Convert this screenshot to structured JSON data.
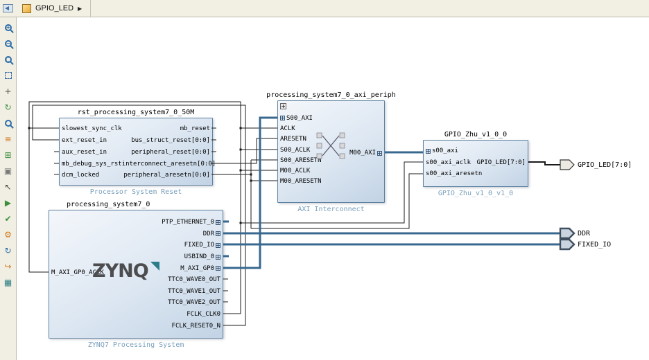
{
  "window": {
    "tab": {
      "label": "GPIO_LED",
      "arrow": "▶"
    }
  },
  "toolbar": {
    "icons": [
      {
        "name": "zoom-in",
        "badge": "+"
      },
      {
        "name": "zoom-out",
        "badge": "−"
      },
      {
        "name": "zoom-fit",
        "badge": "□"
      },
      {
        "name": "select-area"
      },
      {
        "name": "fit-selection",
        "glyph": "+"
      },
      {
        "name": "autofit-selection",
        "glyph": "↻"
      },
      {
        "name": "search",
        "badge": ""
      },
      {
        "name": "collapse-expand",
        "glyph": "≡"
      },
      {
        "name": "add-ip",
        "glyph": "⊞"
      },
      {
        "name": "add-hierarchy",
        "glyph": "▣"
      },
      {
        "name": "make-external",
        "glyph": "↖"
      },
      {
        "name": "run-automation",
        "glyph": "▶"
      },
      {
        "name": "validate-design",
        "glyph": "✔"
      },
      {
        "name": "settings",
        "glyph": "⚙"
      },
      {
        "name": "regenerate-layout",
        "glyph": "↻"
      },
      {
        "name": "optimize-routing",
        "glyph": "↪"
      },
      {
        "name": "toggle-grid",
        "glyph": "▦"
      }
    ]
  },
  "diagram": {
    "blocks": {
      "reset": {
        "instance": "rst_processing_system7_0_50M",
        "type_label": "Processor System Reset",
        "left_ports": [
          "slowest_sync_clk",
          "ext_reset_in",
          "aux_reset_in",
          "mb_debug_sys_rst",
          "dcm_locked"
        ],
        "right_ports": [
          "mb_reset",
          "bus_struct_reset[0:0]",
          "peripheral_reset[0:0]",
          "interconnect_aresetn[0:0]",
          "peripheral_aresetn[0:0]"
        ]
      },
      "axi": {
        "instance": "processing_system7_0_axi_periph",
        "type_label": "AXI Interconnect",
        "left_ports": [
          "S00_AXI",
          "ACLK",
          "ARESETN",
          "S00_ACLK",
          "S00_ARESETN",
          "M00_ACLK",
          "M00_ARESETN"
        ],
        "right_ports": [
          "M00_AXI"
        ]
      },
      "gpio": {
        "instance": "GPIO_Zhu_v1_0_0",
        "type_label": "GPIO_Zhu_v1_0_v1_0",
        "left_ports": [
          "s00_axi",
          "s00_axi_aclk",
          "s00_axi_aresetn"
        ],
        "right_ports": [
          "GPIO_LED[7:0]"
        ]
      },
      "zynq": {
        "instance": "processing_system7_0",
        "type_label": "ZYNQ7 Processing System",
        "logo": "ZYNQ",
        "left_ports": [
          "M_AXI_GP0_ACLK"
        ],
        "right_ports": [
          "PTP_ETHERNET_0",
          "DDR",
          "FIXED_IO",
          "USBIND_0",
          "M_AXI_GP0",
          "TTC0_WAVE0_OUT",
          "TTC0_WAVE1_OUT",
          "TTC0_WAVE2_OUT",
          "FCLK_CLK0",
          "FCLK_RESET0_N"
        ]
      }
    },
    "external_ports": {
      "gpio_led": "GPIO_LED[7:0]",
      "ddr": "DDR",
      "fixed_io": "FIXED_IO"
    }
  },
  "colors": {
    "interface_wire": "#38688f",
    "signal_wire": "#1a1a1a",
    "block_border": "#5e82a0",
    "type_label": "#7aa0bc",
    "chrome_background": "#f2f0e3"
  }
}
